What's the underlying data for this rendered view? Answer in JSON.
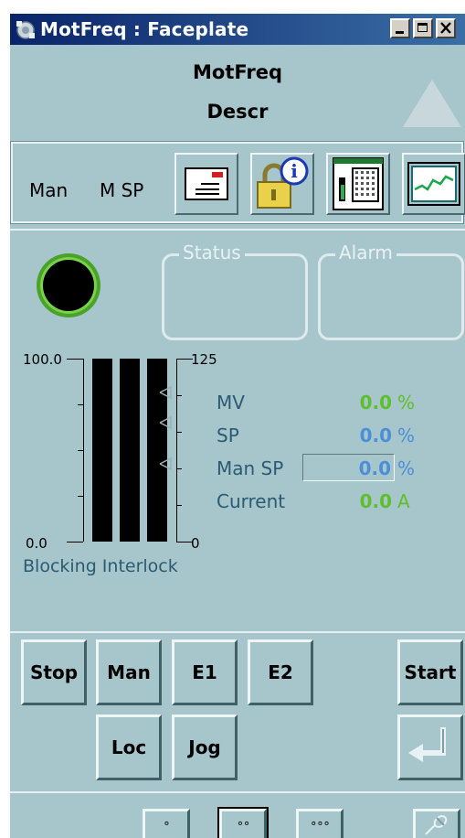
{
  "window": {
    "title": "MotFreq : Faceplate",
    "minimize_label": "_",
    "maximize_label": "□",
    "close_label": "X"
  },
  "header": {
    "tag_name": "MotFreq",
    "description": "Descr"
  },
  "toolbar": {
    "mode_label": "Man",
    "setpoint_label": "M SP",
    "buttons": [
      {
        "name": "message",
        "icon": "message-icon"
      },
      {
        "name": "info-security",
        "icon": "lock-info-icon"
      },
      {
        "name": "parameters",
        "icon": "parameter-view-icon"
      },
      {
        "name": "trend",
        "icon": "trend-icon"
      }
    ]
  },
  "groups": {
    "status_label": "Status",
    "alarm_label": "Alarm"
  },
  "scales": {
    "left_max": "100.0",
    "left_min": "0.0",
    "right_max": "125",
    "right_min": "0"
  },
  "values": {
    "mv_label": "MV",
    "mv_value": "0.0",
    "mv_unit": "%",
    "sp_label": "SP",
    "sp_value": "0.0",
    "sp_unit": "%",
    "manSp_label": "Man SP",
    "manSp_value": "0.0",
    "manSp_unit": "%",
    "current_label": "Current",
    "current_value": "0.0",
    "current_unit": "A"
  },
  "interlock_label": "Blocking Interlock",
  "commands": {
    "stop": "Stop",
    "man": "Man",
    "e1": "E1",
    "e2": "E2",
    "start": "Start",
    "loc": "Loc",
    "jog": "Jog"
  },
  "view_buttons": {
    "view1": "∘",
    "view2": "∘∘",
    "view3": "∘∘∘"
  },
  "colors": {
    "panel": "#a7c6cc",
    "value_green": "#5dbf2a",
    "value_blue": "#4b8fd8",
    "status_ring": "#5dbf2a"
  }
}
